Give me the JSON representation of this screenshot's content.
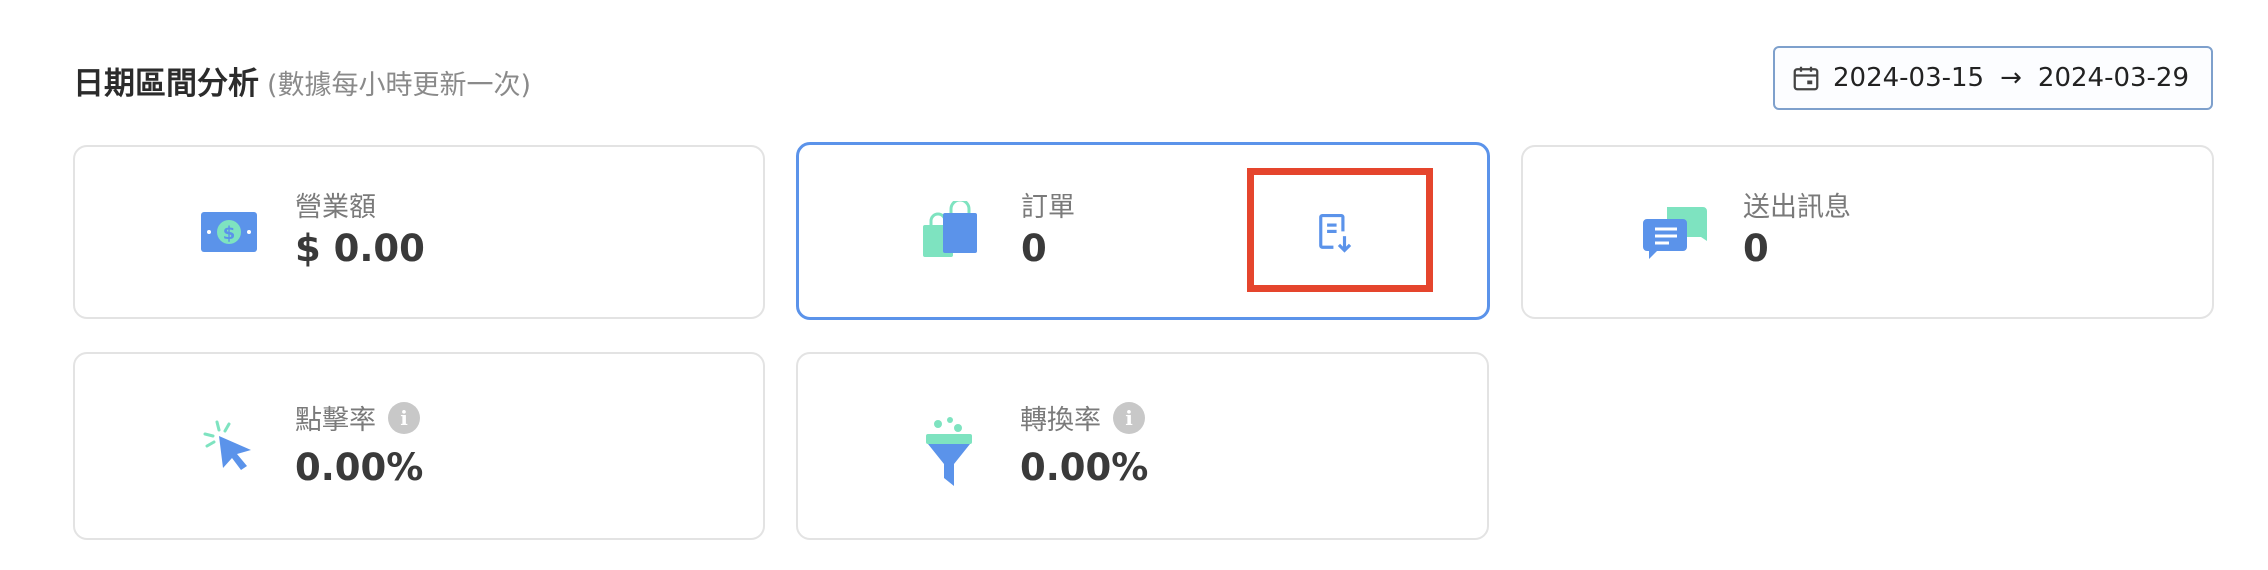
{
  "header": {
    "title": "日期區間分析",
    "subtitle": "(數據每小時更新一次)"
  },
  "date_range": {
    "start": "2024-03-15",
    "separator": "→",
    "end": "2024-03-29",
    "icon": "calendar-icon"
  },
  "cards": [
    {
      "label": "營業額",
      "value": "$ 0.00",
      "icon": "money-icon"
    },
    {
      "label": "訂單",
      "value": "0",
      "icon": "shopping-bags-icon",
      "action_icon": "export-document-icon"
    },
    {
      "label": "送出訊息",
      "value": "0",
      "icon": "chat-bubbles-icon"
    },
    {
      "label": "點擊率",
      "value": "0.00%",
      "icon": "click-cursor-icon",
      "info_icon": "info-icon"
    },
    {
      "label": "轉換率",
      "value": "0.00%",
      "icon": "funnel-icon",
      "info_icon": "info-icon"
    }
  ],
  "info_glyph": "i",
  "colors": {
    "accent": "#5b93ea",
    "mint": "#7ee3c0",
    "highlight": "#e5452d",
    "border": "#e3e3e3"
  }
}
